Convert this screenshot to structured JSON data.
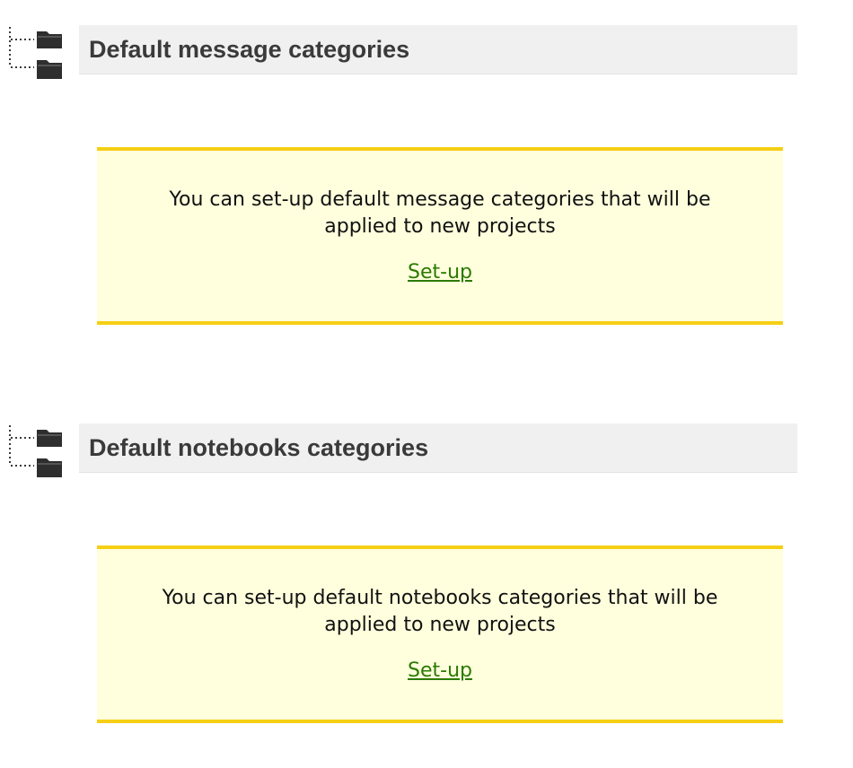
{
  "sections": [
    {
      "icon": "folder-tree-icon",
      "title": "Default message categories",
      "notice": {
        "text": "You can set-up default message categories that will be applied to new projects",
        "link_label": "Set-up"
      }
    },
    {
      "icon": "folder-tree-icon",
      "title": "Default notebooks categories",
      "notice": {
        "text": "You can set-up default notebooks categories that will be applied to new projects",
        "link_label": "Set-up"
      }
    }
  ],
  "colors": {
    "header_background": "#f0f0f0",
    "notice_background": "#ffffdd",
    "notice_border": "#f6cf14",
    "link": "#2b7a00",
    "title_text": "#3a3a3a"
  }
}
